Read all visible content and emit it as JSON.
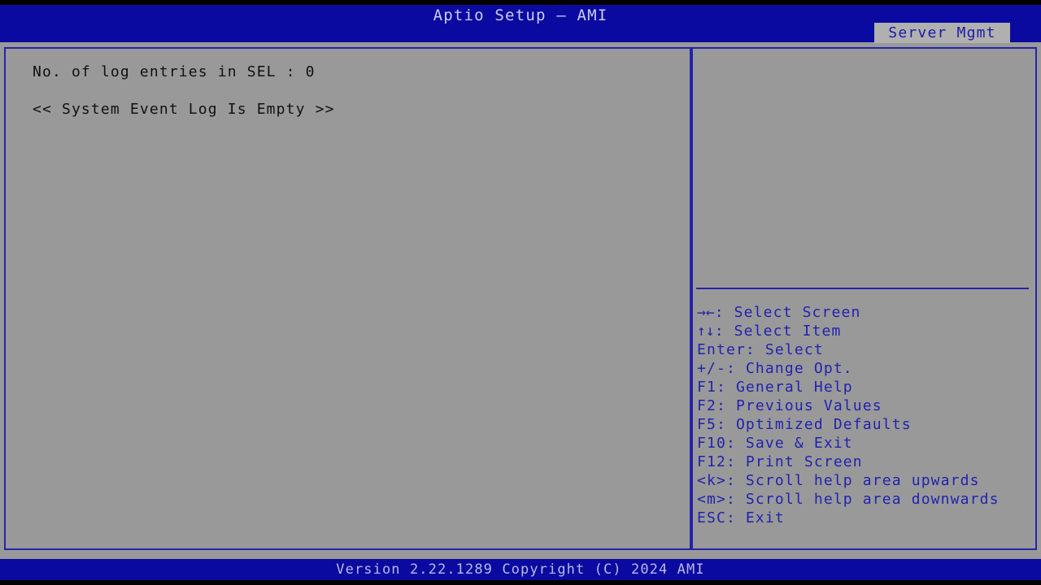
{
  "header": {
    "title": "Aptio Setup – AMI",
    "bg_color": "#0a0aa0",
    "text_color": "#ccccf0"
  },
  "tabs": {
    "active_label": "Server Mgmt",
    "active_bg": "#b0b0b0",
    "active_text_color": "#1a1aa8"
  },
  "main": {
    "sel_count_line": "No. of log entries in SEL : 0",
    "sel_empty_line": "<< System Event Log Is Empty >>",
    "text_color": "#111111",
    "panel_bg": "#999999",
    "border_color": "#2424a8"
  },
  "help": {
    "items": [
      {
        "glyph": "→←",
        "label": ": Select Screen"
      },
      {
        "glyph": "↑↓",
        "label": ": Select Item"
      },
      {
        "glyph": "",
        "label": "Enter: Select"
      },
      {
        "glyph": "",
        "label": "+/-: Change Opt."
      },
      {
        "glyph": "",
        "label": "F1: General Help"
      },
      {
        "glyph": "",
        "label": "F2: Previous Values"
      },
      {
        "glyph": "",
        "label": "F5: Optimized Defaults"
      },
      {
        "glyph": "",
        "label": "F10: Save & Exit"
      },
      {
        "glyph": "",
        "label": "F12: Print Screen"
      },
      {
        "glyph": "",
        "label": "<k>: Scroll help area upwards"
      },
      {
        "glyph": "",
        "label": "<m>: Scroll help area downwards"
      },
      {
        "glyph": "",
        "label": "ESC: Exit"
      }
    ],
    "text_color": "#2222b0"
  },
  "footer": {
    "version_text": "Version 2.22.1289 Copyright (C) 2024 AMI",
    "bg_color": "#0a0aa0",
    "text_color": "#b8b8e8"
  }
}
